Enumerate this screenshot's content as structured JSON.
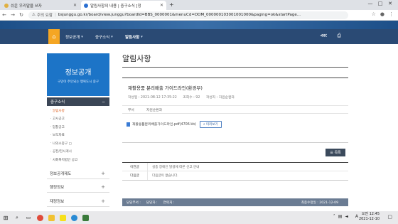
{
  "browser": {
    "tabs": [
      {
        "label": "쉬운 우리말을 쓰자",
        "active": false,
        "icon": "site-favicon",
        "color": "#e0b040"
      },
      {
        "label": "알림사항의 내용 | 중구소식 [정",
        "active": true,
        "icon": "site-favicon",
        "color": "#2a6fd1"
      }
    ],
    "new_tab": "+",
    "security_label": "주의 요함",
    "url": "bsjunggu.go.kr/board/view.junggu?boardId=BBS_0000001&menuCd=DOM_000000103001001000&paging=ok&startPage...",
    "window_controls": [
      "—",
      "□",
      "✕"
    ]
  },
  "site": {
    "breadcrumbs": [
      "정보공개",
      "중구소식",
      "알림사항"
    ],
    "home_icon": "home-icon"
  },
  "sidebar": {
    "title": "정보공개",
    "slogan": "구민이 주인되는 행복도시 중구",
    "section": "중구소식",
    "items": [
      {
        "label": "알림사항",
        "active": true
      },
      {
        "label": "고시공고",
        "active": false
      },
      {
        "label": "입찰공고",
        "active": false
      },
      {
        "label": "보도자료",
        "active": false
      },
      {
        "label": "나의소중구 ▢",
        "active": false
      },
      {
        "label": "공전/전시게시",
        "active": false
      },
      {
        "label": "사회복지법인 공고",
        "active": false
      }
    ],
    "groups": [
      "정보공개제도",
      "행정정보",
      "재정정보"
    ]
  },
  "main": {
    "page_title": "알림사항",
    "post": {
      "title": "재활용품 분리배출 가이드라인(환경부)",
      "date_label": "작성일 : 2021-08-12 17:35:22",
      "views_label": "조회수 : 92",
      "author_label": "작성자 : 자원순환과",
      "dept_label": "부서",
      "dept_value": "자원순환과",
      "attachment": "재활용품분리배출가이드라인.pdf(4706 kb)",
      "preview_label": "미리보기"
    },
    "list_button": "목록",
    "prevnext": [
      {
        "key": "이전글",
        "value": "실종 장애인 발생에 따른 신고 안내"
      },
      {
        "key": "다음글",
        "value": "다음글이 없습니다."
      }
    ],
    "infobar": {
      "manager": "담당부서 :",
      "phone": "담당자 :",
      "contact": "연락처 :",
      "updated": "최종수정일 : 2021-12-09"
    }
  },
  "taskbar": {
    "lang": "A",
    "time": "오전 12:45",
    "date": "2021-12-10"
  }
}
